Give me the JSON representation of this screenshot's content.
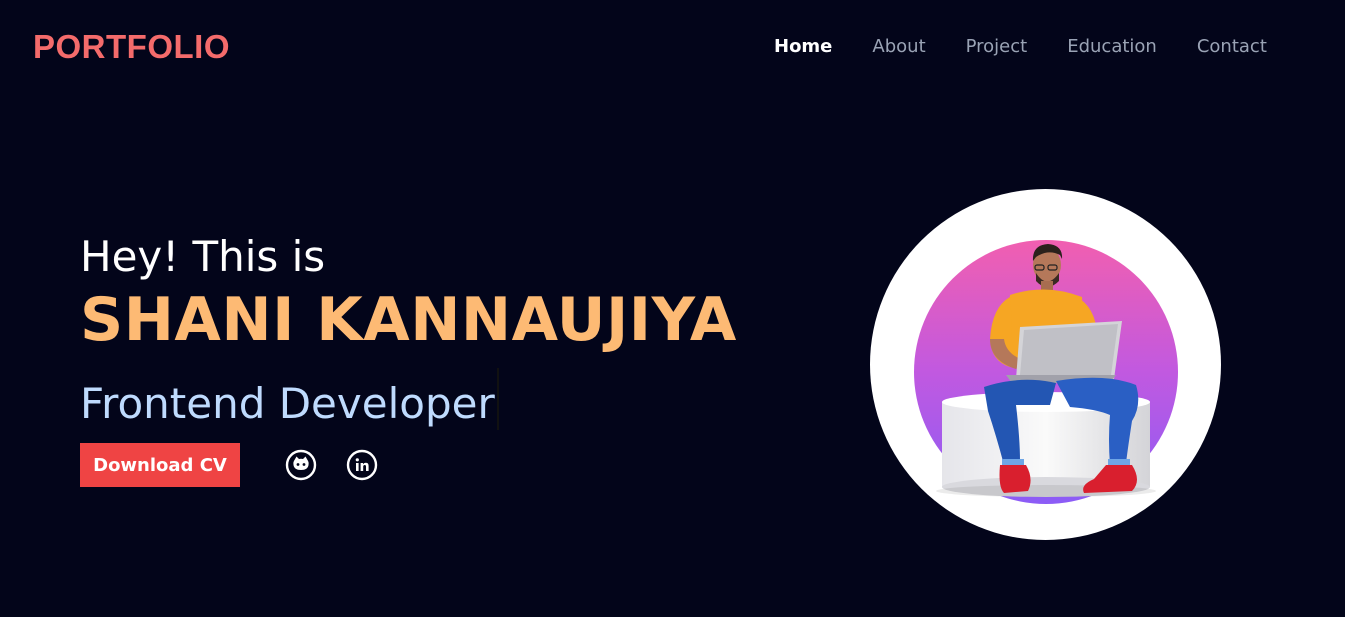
{
  "header": {
    "logo": "PORTFOLIO",
    "nav": [
      {
        "label": "Home",
        "active": true
      },
      {
        "label": "About",
        "active": false
      },
      {
        "label": "Project",
        "active": false
      },
      {
        "label": "Education",
        "active": false
      },
      {
        "label": "Contact",
        "active": false
      }
    ]
  },
  "hero": {
    "greeting": "Hey! This is",
    "name": "SHANI KANNAUJIYA",
    "role": "Frontend Developer",
    "cv_button": "Download CV",
    "socials": [
      {
        "icon": "github-icon"
      },
      {
        "icon": "linkedin-icon"
      }
    ]
  },
  "colors": {
    "background": "#03051a",
    "logo": "#f46b6b",
    "name": "#fdba74",
    "role": "#bfdbfe",
    "button": "#ef4444"
  }
}
